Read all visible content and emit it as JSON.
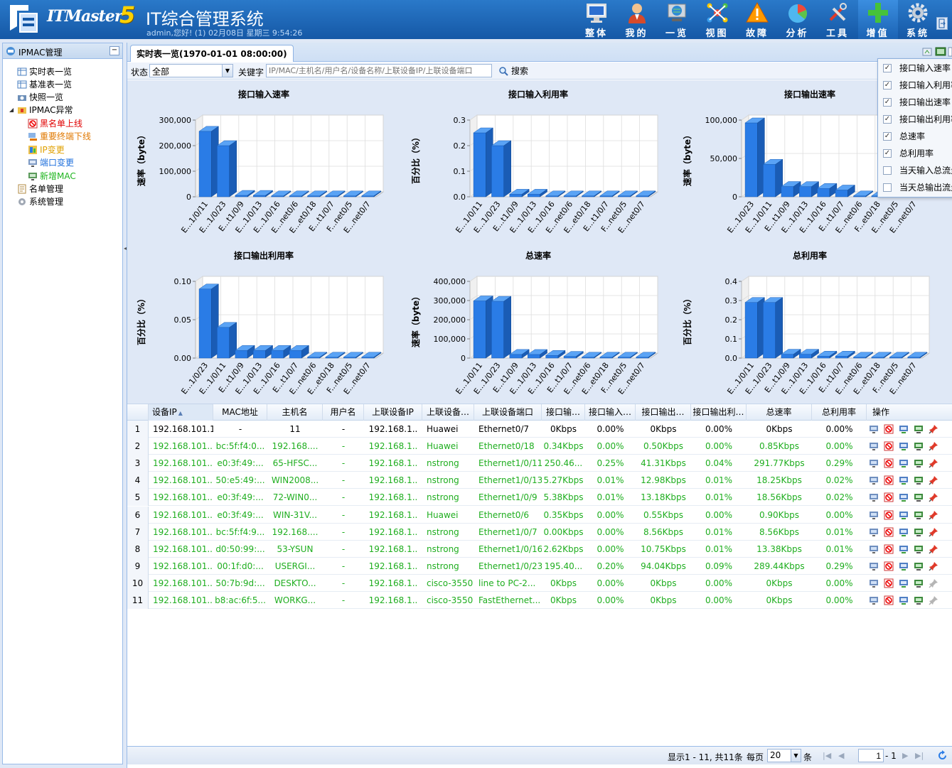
{
  "app": {
    "brand": "ITMaster",
    "version": "5",
    "title": "IT综合管理系统",
    "welcome": "admin,您好! (1) 02月08日 星期三 9:54:26"
  },
  "nav": [
    {
      "label": "整体",
      "icon": "monitor-icon"
    },
    {
      "label": "我的",
      "icon": "user-icon"
    },
    {
      "label": "一览",
      "icon": "globe-monitor-icon"
    },
    {
      "label": "视图",
      "icon": "network-icon"
    },
    {
      "label": "故障",
      "icon": "warning-icon"
    },
    {
      "label": "分析",
      "icon": "pie-chart-icon"
    },
    {
      "label": "工具",
      "icon": "tools-icon"
    },
    {
      "label": "增值",
      "icon": "plus-icon"
    },
    {
      "label": "系统",
      "icon": "gear-icon"
    }
  ],
  "sidebar": {
    "title": "IPMAC管理",
    "collapse": "−",
    "items": [
      {
        "label": "实时表一览",
        "color": "#000000"
      },
      {
        "label": "基准表一览",
        "color": "#000000"
      },
      {
        "label": "快照一览",
        "color": "#000000"
      },
      {
        "label": "IPMAC异常",
        "color": "#000000"
      },
      {
        "label": "黑名单上线",
        "color": "#e00000"
      },
      {
        "label": "重要终端下线",
        "color": "#e07800"
      },
      {
        "label": "IP变更",
        "color": "#e0a000"
      },
      {
        "label": "端口变更",
        "color": "#1e6fdc"
      },
      {
        "label": "新增MAC",
        "color": "#1fb51f"
      },
      {
        "label": "名单管理",
        "color": "#000000"
      },
      {
        "label": "系统管理",
        "color": "#000000"
      }
    ]
  },
  "tab": {
    "label": "实时表一览(1970-01-01 08:00:00)"
  },
  "filter": {
    "status_label": "状态",
    "status_value": "全部",
    "keyword_label": "关键字",
    "keyword_placeholder": "IP/MAC/主机名/用户名/设备名称/上联设备IP/上联设备端口",
    "search_label": "搜索"
  },
  "column_menu": [
    {
      "label": "接口输入速率",
      "checked": true
    },
    {
      "label": "接口输入利用率",
      "checked": true
    },
    {
      "label": "接口输出速率",
      "checked": true
    },
    {
      "label": "接口输出利用率",
      "checked": true
    },
    {
      "label": "总速率",
      "checked": true
    },
    {
      "label": "总利用率",
      "checked": true
    },
    {
      "label": "当天输入总流量",
      "checked": false
    },
    {
      "label": "当天总输出流量",
      "checked": false
    }
  ],
  "chart_data": [
    {
      "type": "bar",
      "title": "接口输入速率",
      "ylabel": "速率（byte）",
      "ylim": [
        0,
        300000
      ],
      "yticks": [
        0,
        100000,
        200000,
        300000
      ],
      "ytick_labels": [
        "0",
        "100,000",
        "200,000",
        "300,000"
      ],
      "categories": [
        "E...1/0/11",
        "E...1/0/23",
        "E...t1/0/9",
        "E...1/0/13",
        "E...1/0/16",
        "E...net0/6",
        "E...et0/18",
        "E...t1/0/7",
        "F...net0/5",
        "E...net0/7"
      ],
      "values": [
        256000,
        200000,
        5500,
        5400,
        2700,
        0,
        0,
        0,
        0,
        0
      ]
    },
    {
      "type": "bar",
      "title": "接口输入利用率",
      "ylabel": "百分比（%）",
      "ylim": [
        0,
        0.3
      ],
      "yticks": [
        0,
        0.1,
        0.2,
        0.3
      ],
      "ytick_labels": [
        "0.0",
        "0.1",
        "0.2",
        "0.3"
      ],
      "categories": [
        "E...1/0/11",
        "E...1/0/23",
        "E...t1/0/9",
        "E...1/0/13",
        "E...1/0/16",
        "E...net0/6",
        "E...et0/18",
        "E...t1/0/7",
        "F...net0/5",
        "E...net0/7"
      ],
      "values": [
        0.25,
        0.2,
        0.01,
        0.01,
        0,
        0,
        0,
        0,
        0,
        0
      ]
    },
    {
      "type": "bar",
      "title": "接口输出速率",
      "ylabel": "速率（byte）",
      "ylim": [
        0,
        100000
      ],
      "yticks": [
        0,
        50000,
        100000
      ],
      "ytick_labels": [
        "0",
        "50,000",
        "100,000"
      ],
      "categories": [
        "E...1/0/23",
        "E...1/0/11",
        "E...t1/0/9",
        "E...1/0/13",
        "E...1/0/16",
        "E...t1/0/7",
        "E...net0/6",
        "F...et0/18",
        "E...net0/5",
        "E...net0/7"
      ],
      "values": [
        96300,
        42300,
        13400,
        13300,
        10900,
        8800,
        0,
        0,
        0,
        0
      ]
    },
    {
      "type": "bar",
      "title": "接口输出利用率",
      "ylabel": "百分比（%）",
      "ylim": [
        0,
        0.1
      ],
      "yticks": [
        0,
        0.05,
        0.1
      ],
      "ytick_labels": [
        "0.00",
        "0.05",
        "0.10"
      ],
      "categories": [
        "E...1/0/23",
        "E...1/0/11",
        "E...t1/0/9",
        "E...1/0/13",
        "E...1/0/16",
        "E...t1/0/7",
        "E...net0/6",
        "E...et0/18",
        "F...net0/5",
        "E...net0/7"
      ],
      "values": [
        0.09,
        0.04,
        0.01,
        0.01,
        0.01,
        0.01,
        0,
        0,
        0,
        0
      ]
    },
    {
      "type": "bar",
      "title": "总速率",
      "ylabel": "速率（byte）",
      "ylim": [
        0,
        400000
      ],
      "yticks": [
        0,
        100000,
        200000,
        300000,
        400000
      ],
      "ytick_labels": [
        "0",
        "100,000",
        "200,000",
        "300,000",
        "400,000"
      ],
      "categories": [
        "E...1/0/11",
        "E...1/0/23",
        "E...t1/0/9",
        "E...1/0/13",
        "E...1/0/16",
        "E...t1/0/7",
        "E...net0/6",
        "E...et0/18",
        "F...net0/5",
        "E...net0/7"
      ],
      "values": [
        298000,
        296000,
        19000,
        18700,
        13700,
        8800,
        0,
        0,
        0,
        0
      ]
    },
    {
      "type": "bar",
      "title": "总利用率",
      "ylabel": "百分比（%）",
      "ylim": [
        0,
        0.4
      ],
      "yticks": [
        0,
        0.1,
        0.2,
        0.3,
        0.4
      ],
      "ytick_labels": [
        "0.0",
        "0.1",
        "0.2",
        "0.3",
        "0.4"
      ],
      "categories": [
        "E...1/0/11",
        "E...1/0/23",
        "E...t1/0/9",
        "E...1/0/13",
        "E...1/0/16",
        "E...t1/0/7",
        "E...net0/6",
        "E...et0/18",
        "F...net0/5",
        "E...net0/7"
      ],
      "values": [
        0.29,
        0.29,
        0.02,
        0.02,
        0.01,
        0.01,
        0,
        0,
        0,
        0
      ]
    }
  ],
  "grid": {
    "columns": [
      "设备IP",
      "MAC地址",
      "主机名",
      "用户名",
      "上联设备IP",
      "上联设备…",
      "上联设备端口",
      "接口输…",
      "接口输入…",
      "接口输出…",
      "接口输出利…",
      "总速率",
      "总利用率",
      "操作"
    ],
    "sort_indicator": "▲",
    "rows": [
      {
        "n": "1",
        "ip": "192.168.101.1",
        "mac": "-",
        "host": "11",
        "user": "-",
        "upip": "192.168.1..",
        "dev": "Huawei",
        "port": "Ethernet0/7",
        "in": "0Kbps",
        "inu": "0.00%",
        "out": "0Kbps",
        "outu": "0.00%",
        "tot": "0Kbps",
        "totu": "0.00%",
        "color": "#000000"
      },
      {
        "n": "2",
        "ip": "192.168.101...",
        "mac": "bc:5f:f4:0...",
        "host": "192.168....",
        "user": "-",
        "upip": "192.168.1..",
        "dev": "Huawei",
        "port": "Ethernet0/18",
        "in": "0.34Kbps",
        "inu": "0.00%",
        "out": "0.50Kbps",
        "outu": "0.00%",
        "tot": "0.85Kbps",
        "totu": "0.00%",
        "color": "#1fae1f"
      },
      {
        "n": "3",
        "ip": "192.168.101...",
        "mac": "e0:3f:49:...",
        "host": "65-HFSC...",
        "user": "-",
        "upip": "192.168.1..",
        "dev": "nstrong",
        "port": "Ethernet1/0/11",
        "in": "250.46...",
        "inu": "0.25%",
        "out": "41.31Kbps",
        "outu": "0.04%",
        "tot": "291.77Kbps",
        "totu": "0.29%",
        "color": "#1fae1f"
      },
      {
        "n": "4",
        "ip": "192.168.101...",
        "mac": "50:e5:49:...",
        "host": "WIN2008...",
        "user": "-",
        "upip": "192.168.1..",
        "dev": "nstrong",
        "port": "Ethernet1/0/13",
        "in": "5.27Kbps",
        "inu": "0.01%",
        "out": "12.98Kbps",
        "outu": "0.01%",
        "tot": "18.25Kbps",
        "totu": "0.02%",
        "color": "#1fae1f"
      },
      {
        "n": "5",
        "ip": "192.168.101...",
        "mac": "e0:3f:49:...",
        "host": "72-WIN0...",
        "user": "-",
        "upip": "192.168.1..",
        "dev": "nstrong",
        "port": "Ethernet1/0/9",
        "in": "5.38Kbps",
        "inu": "0.01%",
        "out": "13.18Kbps",
        "outu": "0.01%",
        "tot": "18.56Kbps",
        "totu": "0.02%",
        "color": "#1fae1f"
      },
      {
        "n": "6",
        "ip": "192.168.101...",
        "mac": "e0:3f:49:...",
        "host": "WIN-31V...",
        "user": "-",
        "upip": "192.168.1..",
        "dev": "Huawei",
        "port": "Ethernet0/6",
        "in": "0.35Kbps",
        "inu": "0.00%",
        "out": "0.55Kbps",
        "outu": "0.00%",
        "tot": "0.90Kbps",
        "totu": "0.00%",
        "color": "#1fae1f"
      },
      {
        "n": "7",
        "ip": "192.168.101...",
        "mac": "bc:5f:f4:9...",
        "host": "192.168....",
        "user": "-",
        "upip": "192.168.1..",
        "dev": "nstrong",
        "port": "Ethernet1/0/7",
        "in": "0.00Kbps",
        "inu": "0.00%",
        "out": "8.56Kbps",
        "outu": "0.01%",
        "tot": "8.56Kbps",
        "totu": "0.01%",
        "color": "#1fae1f"
      },
      {
        "n": "8",
        "ip": "192.168.101...",
        "mac": "d0:50:99:...",
        "host": "53-YSUN",
        "user": "-",
        "upip": "192.168.1..",
        "dev": "nstrong",
        "port": "Ethernet1/0/16",
        "in": "2.62Kbps",
        "inu": "0.00%",
        "out": "10.75Kbps",
        "outu": "0.01%",
        "tot": "13.38Kbps",
        "totu": "0.01%",
        "color": "#1fae1f"
      },
      {
        "n": "9",
        "ip": "192.168.101...",
        "mac": "00:1f:d0:...",
        "host": "USERGI...",
        "user": "-",
        "upip": "192.168.1..",
        "dev": "nstrong",
        "port": "Ethernet1/0/23",
        "in": "195.40...",
        "inu": "0.20%",
        "out": "94.04Kbps",
        "outu": "0.09%",
        "tot": "289.44Kbps",
        "totu": "0.29%",
        "color": "#1fae1f"
      },
      {
        "n": "10",
        "ip": "192.168.101...",
        "mac": "50:7b:9d:...",
        "host": "DESKTO...",
        "user": "-",
        "upip": "192.168.1..",
        "dev": "cisco-3550",
        "port": "line to PC-2...",
        "in": "0Kbps",
        "inu": "0.00%",
        "out": "0Kbps",
        "outu": "0.00%",
        "tot": "0Kbps",
        "totu": "0.00%",
        "color": "#1fae1f"
      },
      {
        "n": "11",
        "ip": "192.168.101...",
        "mac": "b8:ac:6f:5...",
        "host": "WORKG...",
        "user": "-",
        "upip": "192.168.1..",
        "dev": "cisco-3550",
        "port": "FastEthernet...",
        "in": "0Kbps",
        "inu": "0.00%",
        "out": "0Kbps",
        "outu": "0.00%",
        "tot": "0Kbps",
        "totu": "0.00%",
        "color": "#1fae1f"
      }
    ]
  },
  "pager": {
    "summary": "显示1 - 11, 共11条",
    "per_page_label": "每页",
    "per_page": "20",
    "unit": "条",
    "page": "1",
    "total_pages": "- 1"
  },
  "colors": {
    "accent": "#1558a6",
    "bar": "#2a7ce6",
    "green_row": "#1fae1f"
  }
}
